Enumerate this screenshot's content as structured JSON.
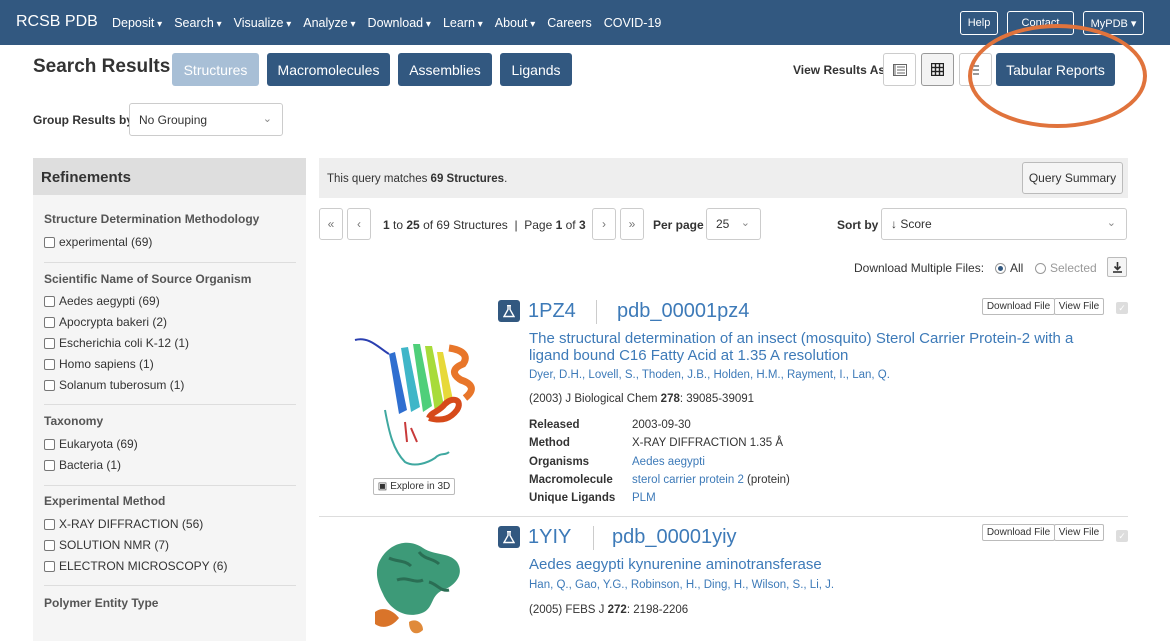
{
  "nav": {
    "brand": "RCSB PDB",
    "items": [
      "Deposit",
      "Search",
      "Visualize",
      "Analyze",
      "Download",
      "Learn",
      "About"
    ],
    "plain_items": [
      "Careers",
      "COVID-19"
    ],
    "help": "Help",
    "contact": "Contact",
    "mypdb": "MyPDB ▾"
  },
  "header": {
    "title": "Search Results",
    "tabs": [
      "Structures",
      "Macromolecules",
      "Assemblies",
      "Ligands"
    ],
    "view_label": "View Results As",
    "tabular": "Tabular Reports"
  },
  "grouping": {
    "label": "Group Results by",
    "value": "No Grouping"
  },
  "refinements": {
    "title": "Refinements",
    "groups": [
      {
        "title": "Structure Determination Methodology",
        "items": [
          "experimental (69)"
        ]
      },
      {
        "title": "Scientific Name of Source Organism",
        "items": [
          "Aedes aegypti (69)",
          "Apocrypta bakeri (2)",
          "Escherichia coli K-12 (1)",
          "Homo sapiens (1)",
          "Solanum tuberosum (1)"
        ]
      },
      {
        "title": "Taxonomy",
        "items": [
          "Eukaryota (69)",
          "Bacteria (1)"
        ]
      },
      {
        "title": "Experimental Method",
        "items": [
          "X-RAY DIFFRACTION (56)",
          "SOLUTION NMR (7)",
          "ELECTRON MICROSCOPY (6)"
        ]
      },
      {
        "title": "Polymer Entity Type",
        "items": []
      }
    ]
  },
  "query": {
    "pre": "This query matches ",
    "count": "69 Structures",
    "post": ".",
    "summary": "Query Summary"
  },
  "pager": {
    "from": "1",
    "to": "25",
    "total_text": " of 69 Structures",
    "page_label": "Page ",
    "page": "1",
    "of": " of ",
    "pages": "3",
    "per_page_label": "Per page",
    "per_page": "25",
    "sort_label": "Sort by",
    "sort_value": "↓ Score"
  },
  "download": {
    "label": "Download Multiple Files:",
    "all": "All",
    "selected": "Selected"
  },
  "entries": [
    {
      "id": "1PZ4",
      "pdb": "pdb_00001pz4",
      "title": "The structural determination of an insect (mosquito) Sterol Carrier Protein-2 with a ligand bound C16 Fatty Acid at 1.35 A resolution",
      "authors": "Dyer, D.H.,  Lovell, S.,  Thoden, J.B.,  Holden, H.M.,  Rayment, I.,  Lan, Q.",
      "cit_pre": "(2003) J Biological Chem ",
      "cit_vol": "278",
      "cit_post": ": 39085-39091",
      "fields": {
        "released_label": "Released",
        "released": "2003-09-30",
        "method_label": "Method",
        "method": "X-RAY DIFFRACTION 1.35 Å",
        "organisms_label": "Organisms",
        "organisms": "Aedes aegypti",
        "macro_label": "Macromolecule",
        "macro": "sterol carrier protein 2",
        "macro_suffix": " (protein)",
        "ligands_label": "Unique Ligands",
        "ligands": "PLM"
      },
      "explore": "Explore in 3D"
    },
    {
      "id": "1YIY",
      "pdb": "pdb_00001yiy",
      "title": "Aedes aegypti kynurenine aminotransferase",
      "authors": "Han, Q.,  Gao, Y.G.,  Robinson, H.,  Ding, H.,  Wilson, S.,  Li, J.",
      "cit_pre": "(2005) FEBS J ",
      "cit_vol": "272",
      "cit_post": ": 2198-2206"
    }
  ],
  "file_buttons": {
    "download": "Download File",
    "view": "View File"
  },
  "colors": {
    "nav": "#325880",
    "accent": "#3d7ab8",
    "annotation": "#e0733c"
  }
}
